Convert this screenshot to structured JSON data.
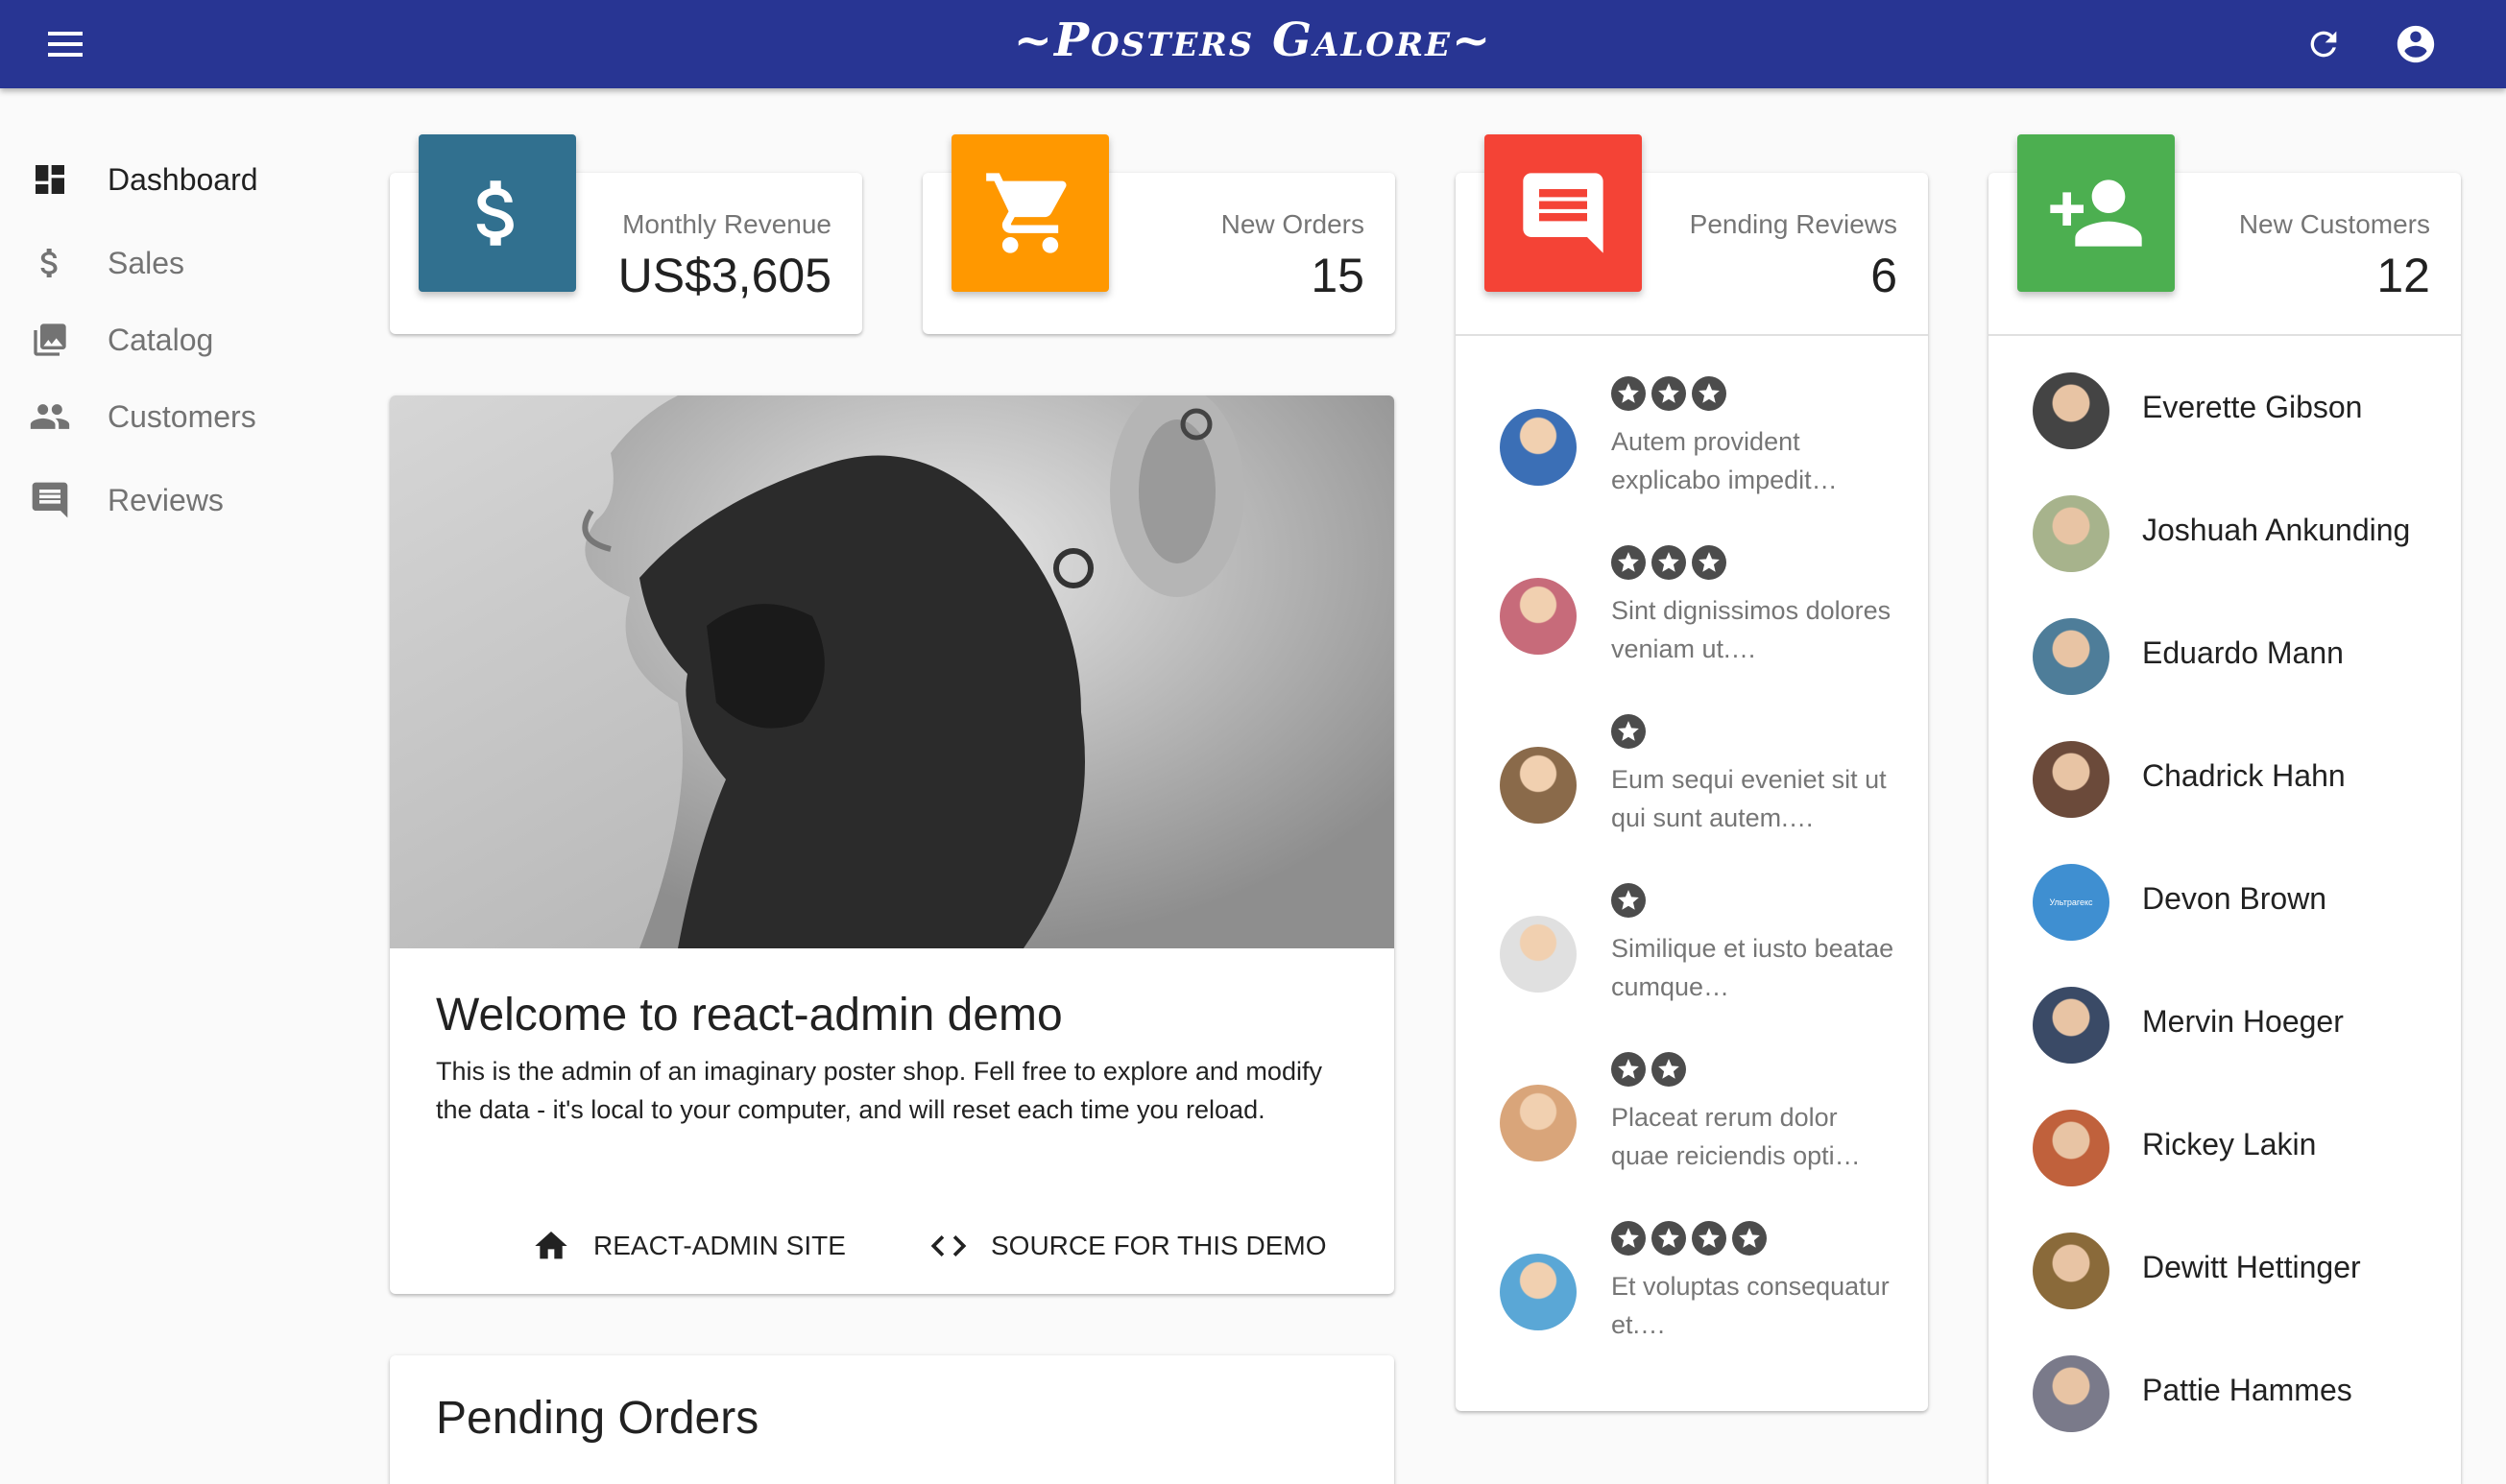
{
  "app": {
    "title": "~Posters Galore~"
  },
  "sidebar": {
    "items": [
      {
        "label": "Dashboard",
        "icon": "dashboard-icon",
        "active": true
      },
      {
        "label": "Sales",
        "icon": "dollar-icon"
      },
      {
        "label": "Catalog",
        "icon": "photo-library-icon"
      },
      {
        "label": "Customers",
        "icon": "people-icon"
      },
      {
        "label": "Reviews",
        "icon": "comment-icon"
      }
    ]
  },
  "stats": {
    "revenue": {
      "label": "Monthly Revenue",
      "value": "US$3,605",
      "color": "#31708f",
      "icon": "dollar-icon"
    },
    "orders": {
      "label": "New Orders",
      "value": "15",
      "color": "#ff9800",
      "icon": "shopping-cart-icon"
    },
    "reviews": {
      "label": "Pending Reviews",
      "value": "6",
      "color": "#f44336",
      "icon": "comment-icon"
    },
    "customers": {
      "label": "New Customers",
      "value": "12",
      "color": "#4caf50",
      "icon": "person-add-icon"
    }
  },
  "welcome": {
    "title": "Welcome to react-admin demo",
    "text": "This is the admin of an imaginary poster shop. Fell free to explore and modify the data - it's local to your computer, and will reset each time you reload.",
    "link_site": "REACT-ADMIN SITE",
    "link_source": "SOURCE FOR THIS DEMO"
  },
  "pending_orders": {
    "title": "Pending Orders"
  },
  "reviews": [
    {
      "rating": 3,
      "text": "Autem provident explicabo impedit…",
      "avatar_color": "#3b6fb6"
    },
    {
      "rating": 3,
      "text": "Sint dignissimos dolores veniam ut.…",
      "avatar_color": "#c76b7a"
    },
    {
      "rating": 1,
      "text": "Eum sequi eveniet sit ut qui sunt autem.…",
      "avatar_color": "#8a6a4a"
    },
    {
      "rating": 1,
      "text": "Similique et iusto beatae cumque…",
      "avatar_color": "#e0e0e0"
    },
    {
      "rating": 2,
      "text": "Placeat rerum dolor quae reiciendis opti…",
      "avatar_color": "#d9a57a"
    },
    {
      "rating": 4,
      "text": "Et voluptas consequatur et.…",
      "avatar_color": "#5aa7d6"
    }
  ],
  "customers": [
    {
      "name": "Everette Gibson",
      "avatar_color": "#444444"
    },
    {
      "name": "Joshuah Ankunding",
      "avatar_color": "#a7b38c"
    },
    {
      "name": "Eduardo Mann",
      "avatar_color": "#4e7d99"
    },
    {
      "name": "Chadrick Hahn",
      "avatar_color": "#6b4a3a"
    },
    {
      "name": "Devon Brown",
      "avatar_color": "#3f8fd1",
      "avatar_text": "Ультрагекс"
    },
    {
      "name": "Mervin Hoeger",
      "avatar_color": "#3a4a66"
    },
    {
      "name": "Rickey Lakin",
      "avatar_color": "#c0613c"
    },
    {
      "name": "Dewitt Hettinger",
      "avatar_color": "#8a6a3a"
    },
    {
      "name": "Pattie Hammes",
      "avatar_color": "#7a7a8a"
    }
  ]
}
